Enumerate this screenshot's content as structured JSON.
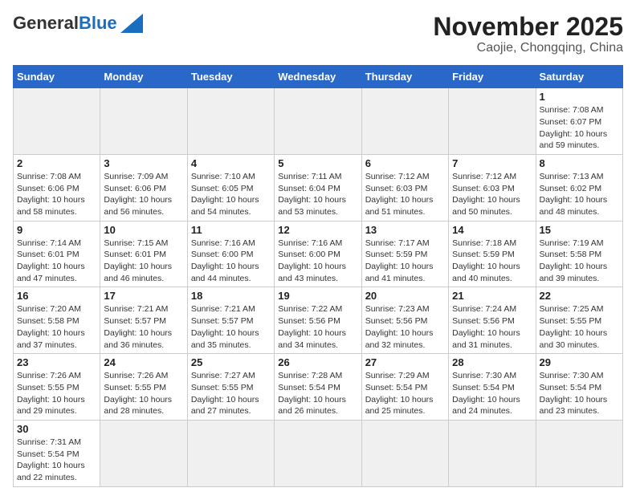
{
  "header": {
    "logo_general": "General",
    "logo_blue": "Blue",
    "month_title": "November 2025",
    "subtitle": "Caojie, Chongqing, China"
  },
  "days_of_week": [
    "Sunday",
    "Monday",
    "Tuesday",
    "Wednesday",
    "Thursday",
    "Friday",
    "Saturday"
  ],
  "weeks": [
    [
      {
        "day": "",
        "info": ""
      },
      {
        "day": "",
        "info": ""
      },
      {
        "day": "",
        "info": ""
      },
      {
        "day": "",
        "info": ""
      },
      {
        "day": "",
        "info": ""
      },
      {
        "day": "",
        "info": ""
      },
      {
        "day": "1",
        "info": "Sunrise: 7:08 AM\nSunset: 6:07 PM\nDaylight: 10 hours and 59 minutes."
      }
    ],
    [
      {
        "day": "2",
        "info": "Sunrise: 7:08 AM\nSunset: 6:06 PM\nDaylight: 10 hours and 58 minutes."
      },
      {
        "day": "3",
        "info": "Sunrise: 7:09 AM\nSunset: 6:06 PM\nDaylight: 10 hours and 56 minutes."
      },
      {
        "day": "4",
        "info": "Sunrise: 7:10 AM\nSunset: 6:05 PM\nDaylight: 10 hours and 54 minutes."
      },
      {
        "day": "5",
        "info": "Sunrise: 7:11 AM\nSunset: 6:04 PM\nDaylight: 10 hours and 53 minutes."
      },
      {
        "day": "6",
        "info": "Sunrise: 7:12 AM\nSunset: 6:03 PM\nDaylight: 10 hours and 51 minutes."
      },
      {
        "day": "7",
        "info": "Sunrise: 7:12 AM\nSunset: 6:03 PM\nDaylight: 10 hours and 50 minutes."
      },
      {
        "day": "8",
        "info": "Sunrise: 7:13 AM\nSunset: 6:02 PM\nDaylight: 10 hours and 48 minutes."
      }
    ],
    [
      {
        "day": "9",
        "info": "Sunrise: 7:14 AM\nSunset: 6:01 PM\nDaylight: 10 hours and 47 minutes."
      },
      {
        "day": "10",
        "info": "Sunrise: 7:15 AM\nSunset: 6:01 PM\nDaylight: 10 hours and 46 minutes."
      },
      {
        "day": "11",
        "info": "Sunrise: 7:16 AM\nSunset: 6:00 PM\nDaylight: 10 hours and 44 minutes."
      },
      {
        "day": "12",
        "info": "Sunrise: 7:16 AM\nSunset: 6:00 PM\nDaylight: 10 hours and 43 minutes."
      },
      {
        "day": "13",
        "info": "Sunrise: 7:17 AM\nSunset: 5:59 PM\nDaylight: 10 hours and 41 minutes."
      },
      {
        "day": "14",
        "info": "Sunrise: 7:18 AM\nSunset: 5:59 PM\nDaylight: 10 hours and 40 minutes."
      },
      {
        "day": "15",
        "info": "Sunrise: 7:19 AM\nSunset: 5:58 PM\nDaylight: 10 hours and 39 minutes."
      }
    ],
    [
      {
        "day": "16",
        "info": "Sunrise: 7:20 AM\nSunset: 5:58 PM\nDaylight: 10 hours and 37 minutes."
      },
      {
        "day": "17",
        "info": "Sunrise: 7:21 AM\nSunset: 5:57 PM\nDaylight: 10 hours and 36 minutes."
      },
      {
        "day": "18",
        "info": "Sunrise: 7:21 AM\nSunset: 5:57 PM\nDaylight: 10 hours and 35 minutes."
      },
      {
        "day": "19",
        "info": "Sunrise: 7:22 AM\nSunset: 5:56 PM\nDaylight: 10 hours and 34 minutes."
      },
      {
        "day": "20",
        "info": "Sunrise: 7:23 AM\nSunset: 5:56 PM\nDaylight: 10 hours and 32 minutes."
      },
      {
        "day": "21",
        "info": "Sunrise: 7:24 AM\nSunset: 5:56 PM\nDaylight: 10 hours and 31 minutes."
      },
      {
        "day": "22",
        "info": "Sunrise: 7:25 AM\nSunset: 5:55 PM\nDaylight: 10 hours and 30 minutes."
      }
    ],
    [
      {
        "day": "23",
        "info": "Sunrise: 7:26 AM\nSunset: 5:55 PM\nDaylight: 10 hours and 29 minutes."
      },
      {
        "day": "24",
        "info": "Sunrise: 7:26 AM\nSunset: 5:55 PM\nDaylight: 10 hours and 28 minutes."
      },
      {
        "day": "25",
        "info": "Sunrise: 7:27 AM\nSunset: 5:55 PM\nDaylight: 10 hours and 27 minutes."
      },
      {
        "day": "26",
        "info": "Sunrise: 7:28 AM\nSunset: 5:54 PM\nDaylight: 10 hours and 26 minutes."
      },
      {
        "day": "27",
        "info": "Sunrise: 7:29 AM\nSunset: 5:54 PM\nDaylight: 10 hours and 25 minutes."
      },
      {
        "day": "28",
        "info": "Sunrise: 7:30 AM\nSunset: 5:54 PM\nDaylight: 10 hours and 24 minutes."
      },
      {
        "day": "29",
        "info": "Sunrise: 7:30 AM\nSunset: 5:54 PM\nDaylight: 10 hours and 23 minutes."
      }
    ],
    [
      {
        "day": "30",
        "info": "Sunrise: 7:31 AM\nSunset: 5:54 PM\nDaylight: 10 hours and 22 minutes."
      },
      {
        "day": "",
        "info": ""
      },
      {
        "day": "",
        "info": ""
      },
      {
        "day": "",
        "info": ""
      },
      {
        "day": "",
        "info": ""
      },
      {
        "day": "",
        "info": ""
      },
      {
        "day": "",
        "info": ""
      }
    ]
  ]
}
